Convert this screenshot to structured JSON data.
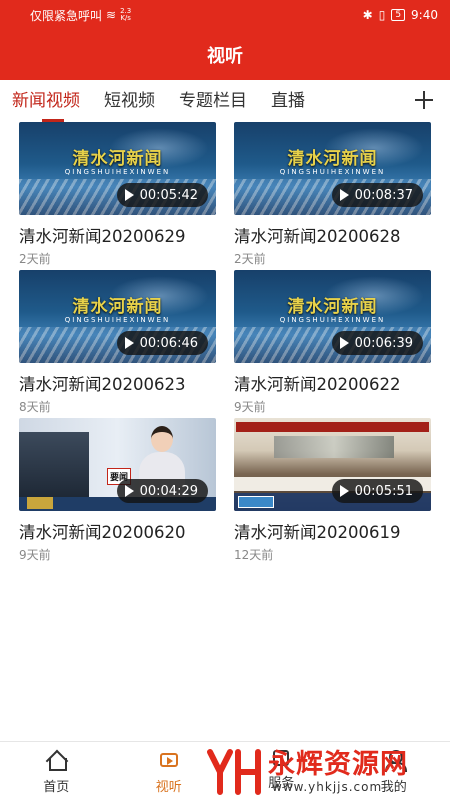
{
  "status_bar": {
    "carrier": "仅限紧急呼叫",
    "net_speed_value": "2.3",
    "net_speed_unit": "K/s",
    "battery": "5",
    "time": "9:40"
  },
  "header": {
    "title": "视听"
  },
  "tabs": [
    {
      "label": "新闻视频",
      "active": true
    },
    {
      "label": "短视频",
      "active": false
    },
    {
      "label": "专题栏目",
      "active": false
    },
    {
      "label": "直播",
      "active": false
    }
  ],
  "thumb_text": {
    "news_title": "清水河新闻",
    "news_subtitle": "QINGSHUIHEXINWEN",
    "anchor_tag": "要闻"
  },
  "videos": [
    {
      "title": "清水河新闻20200629",
      "time_ago": "2天前",
      "duration": "00:05:42",
      "thumb": "news"
    },
    {
      "title": "清水河新闻20200628",
      "time_ago": "2天前",
      "duration": "00:08:37",
      "thumb": "news"
    },
    {
      "title": "清水河新闻20200623",
      "time_ago": "8天前",
      "duration": "00:06:46",
      "thumb": "news"
    },
    {
      "title": "清水河新闻20200622",
      "time_ago": "9天前",
      "duration": "00:06:39",
      "thumb": "news"
    },
    {
      "title": "清水河新闻20200620",
      "time_ago": "9天前",
      "duration": "00:04:29",
      "thumb": "anchor"
    },
    {
      "title": "清水河新闻20200619",
      "time_ago": "12天前",
      "duration": "00:05:51",
      "thumb": "meeting"
    }
  ],
  "bottom_nav": [
    {
      "label": "首页",
      "icon": "home-icon",
      "active": false
    },
    {
      "label": "视听",
      "icon": "video-icon",
      "active": true
    },
    {
      "label": "服务",
      "icon": "service-icon",
      "active": false
    },
    {
      "label": "我的",
      "icon": "mine-icon",
      "active": false
    }
  ],
  "watermark": {
    "text": "永辉资源网",
    "url": "www.yhkjjs.com"
  },
  "colors": {
    "brand_red": "#e12a1c",
    "tab_active": "#c2261a",
    "nav_active": "#d9731f"
  }
}
